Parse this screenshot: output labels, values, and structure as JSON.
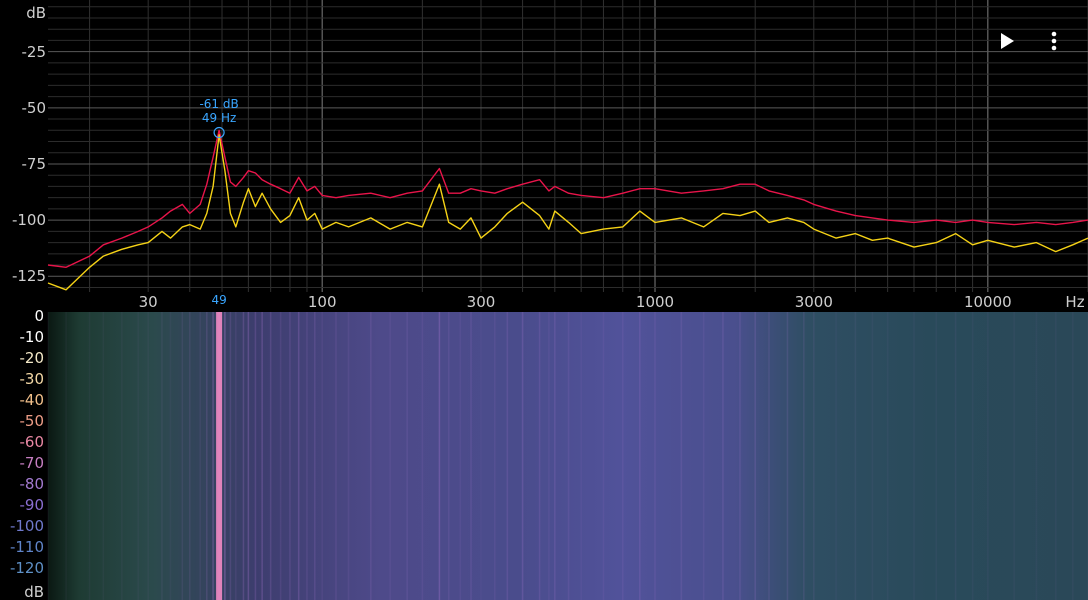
{
  "app": {
    "play_icon": "play-icon",
    "menu_icon": "more-vert-icon"
  },
  "spectrum": {
    "y_unit": "dB",
    "x_unit": "Hz",
    "y_ticks": [
      "-25",
      "-50",
      "-75",
      "-100",
      "-125"
    ],
    "y_tick_values": [
      -25,
      -50,
      -75,
      -100,
      -125
    ],
    "x_ticks": [
      "30",
      "100",
      "300",
      "1000",
      "3000",
      "10000"
    ],
    "x_tick_values": [
      30,
      100,
      300,
      1000,
      3000,
      10000
    ],
    "freq_range": [
      15,
      20000
    ],
    "db_range": [
      -132,
      -2
    ],
    "grid": true,
    "peak": {
      "db_label": "-61 dB",
      "freq_label": "49 Hz",
      "axis_label": "49",
      "freq": 49,
      "db": -61
    },
    "colors": {
      "current": "#f5d216",
      "max_hold": "#e8144a",
      "peak_marker": "#3aa6ff",
      "grid": "#3a3a3a"
    }
  },
  "spectrogram": {
    "db_unit": "dB",
    "scale_labels": [
      "0",
      "-10",
      "-20",
      "-30",
      "-40",
      "-50",
      "-60",
      "-70",
      "-80",
      "-90",
      "-100",
      "-110",
      "-120"
    ],
    "scale_colors": [
      "#ffffff",
      "#ffffff",
      "#f4e9c8",
      "#f2d6a4",
      "#f1bf8a",
      "#ec9c86",
      "#e887a3",
      "#c77fc2",
      "#a37ad0",
      "#8a6ed0",
      "#6f79cc",
      "#5f84c8",
      "#5e90c6"
    ]
  },
  "chart_data": {
    "type": "line",
    "xlabel": "Hz",
    "ylabel": "dB",
    "xscale": "log",
    "xlim": [
      15,
      20000
    ],
    "ylim": [
      -132,
      -2
    ],
    "grid": true,
    "series": [
      {
        "x": [
          15,
          17,
          20,
          22,
          25,
          28,
          30,
          33,
          35,
          38,
          40,
          43,
          45,
          47,
          49,
          51,
          53,
          55,
          58,
          60,
          63,
          66,
          70,
          75,
          80,
          85,
          90,
          95,
          100,
          110,
          120,
          140,
          160,
          180,
          200,
          225,
          240,
          260,
          280,
          300,
          330,
          360,
          400,
          450,
          480,
          500,
          550,
          600,
          700,
          800,
          900,
          1000,
          1200,
          1400,
          1600,
          1800,
          2000,
          2200,
          2500,
          2800,
          3000,
          3500,
          4000,
          4500,
          5000,
          6000,
          7000,
          8000,
          9000,
          10000,
          12000,
          14000,
          16000,
          18000,
          20000
        ],
        "values": [
          -128,
          -131,
          -121,
          -116,
          -113,
          -111,
          -110,
          -105,
          -108,
          -103,
          -102,
          -104,
          -97,
          -85,
          -62,
          -78,
          -97,
          -103,
          -92,
          -86,
          -94,
          -88,
          -95,
          -101,
          -98,
          -90,
          -100,
          -97,
          -104,
          -101,
          -103,
          -99,
          -104,
          -101,
          -103,
          -84,
          -101,
          -104,
          -99,
          -108,
          -103,
          -97,
          -92,
          -98,
          -104,
          -96,
          -101,
          -106,
          -104,
          -103,
          -96,
          -101,
          -99,
          -103,
          -97,
          -98,
          -96,
          -101,
          -99,
          -101,
          -104,
          -108,
          -106,
          -109,
          -108,
          -112,
          -110,
          -106,
          -111,
          -109,
          -112,
          -110,
          -114,
          -111,
          -108
        ]
      },
      {
        "x": [
          15,
          17,
          20,
          22,
          25,
          28,
          30,
          33,
          35,
          38,
          40,
          43,
          45,
          47,
          49,
          51,
          53,
          55,
          58,
          60,
          63,
          66,
          70,
          75,
          80,
          85,
          90,
          95,
          100,
          110,
          120,
          140,
          160,
          180,
          200,
          225,
          240,
          260,
          280,
          300,
          330,
          360,
          400,
          450,
          480,
          500,
          550,
          600,
          700,
          800,
          900,
          1000,
          1200,
          1400,
          1600,
          1800,
          2000,
          2200,
          2500,
          2800,
          3000,
          3500,
          4000,
          4500,
          5000,
          6000,
          7000,
          8000,
          9000,
          10000,
          12000,
          14000,
          16000,
          18000,
          20000
        ],
        "values": [
          -120,
          -121,
          -116,
          -111,
          -108,
          -105,
          -103,
          -99,
          -96,
          -93,
          -97,
          -93,
          -84,
          -72,
          -60,
          -72,
          -83,
          -85,
          -81,
          -78,
          -79,
          -82,
          -84,
          -86,
          -88,
          -81,
          -87,
          -85,
          -89,
          -90,
          -89,
          -88,
          -90,
          -88,
          -87,
          -77,
          -88,
          -88,
          -86,
          -87,
          -88,
          -86,
          -84,
          -82,
          -87,
          -85,
          -88,
          -89,
          -90,
          -88,
          -86,
          -86,
          -88,
          -87,
          -86,
          -84,
          -84,
          -87,
          -89,
          -91,
          -93,
          -96,
          -98,
          -99,
          -100,
          -101,
          -100,
          -101,
          -100,
          -101,
          -102,
          -101,
          -102,
          -101,
          -100
        ]
      }
    ]
  }
}
